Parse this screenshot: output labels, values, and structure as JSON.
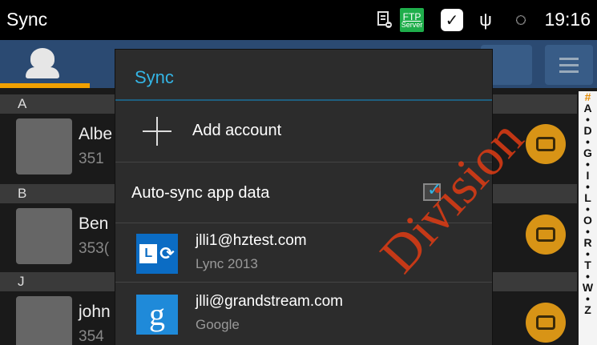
{
  "status_bar": {
    "title": "Sync",
    "time": "19:16",
    "icons": [
      "document-minus-icon",
      "ftp-server-icon",
      "check-icon",
      "usb-icon",
      "sync-icon"
    ],
    "ftp_top": "FTP",
    "ftp_bottom": "Server"
  },
  "toolbar": {
    "tabs": [
      "contacts-tab-icon"
    ],
    "accent_color": "#f0a000"
  },
  "contacts": {
    "list_label": "contacts",
    "sections": [
      {
        "letter": "A",
        "contacts": [
          {
            "name": "Albe",
            "number": "351"
          }
        ]
      },
      {
        "letter": "B",
        "contacts": [
          {
            "name": "Ben",
            "number": "353("
          }
        ]
      },
      {
        "letter": "J",
        "contacts": [
          {
            "name": "john",
            "number": "354"
          }
        ]
      }
    ],
    "alphabet_index": [
      "#",
      "A",
      "•",
      "D",
      "•",
      "G",
      "•",
      "I",
      "•",
      "L",
      "•",
      "O",
      "•",
      "R",
      "•",
      "T",
      "•",
      "W",
      "•",
      "Z"
    ]
  },
  "dialog": {
    "title": "Sync",
    "title_color": "#34b5e5",
    "add_account_label": "Add account",
    "auto_sync_label": "Auto-sync app data",
    "auto_sync_checked": true,
    "accounts": [
      {
        "email": "jlli1@hztest.com",
        "type": "Lync 2013",
        "icon": "lync-logo-icon",
        "logo_text": "L"
      },
      {
        "email": "jlli@grandstream.com",
        "type": "Google",
        "icon": "google-logo-icon",
        "logo_text": "g"
      }
    ]
  },
  "watermark": {
    "text": "Division"
  }
}
